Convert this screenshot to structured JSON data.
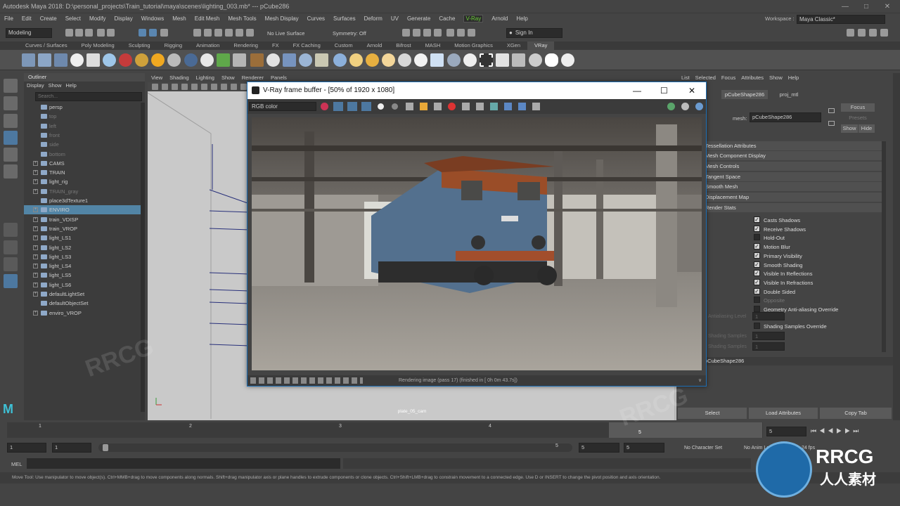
{
  "app": {
    "title": "Autodesk Maya 2018: D:\\personal_projects\\Train_tutorial\\maya\\scenes\\lighting_003.mb*  ---  pCube286"
  },
  "menu": [
    "File",
    "Edit",
    "Create",
    "Select",
    "Modify",
    "Display",
    "Windows",
    "Mesh",
    "Edit Mesh",
    "Mesh Tools",
    "Mesh Display",
    "Curves",
    "Surfaces",
    "Deform",
    "UV",
    "Generate",
    "Cache",
    "V-Ray",
    "Arnold",
    "Help"
  ],
  "workspace": {
    "label": "Workspace :",
    "value": "Maya Classic*"
  },
  "statusline": {
    "mode": "Modeling",
    "live_surface": "No Live Surface",
    "symmetry": "Symmetry: Off",
    "sign_in": "Sign In"
  },
  "shelf_tabs": [
    "Curves / Surfaces",
    "Poly Modeling",
    "Sculpting",
    "Rigging",
    "Animation",
    "Rendering",
    "FX",
    "FX Caching",
    "Custom",
    "Arnold",
    "Bifrost",
    "MASH",
    "Motion Graphics",
    "XGen",
    "VRay"
  ],
  "outliner": {
    "title": "Outliner",
    "menu": [
      "Display",
      "Show",
      "Help"
    ],
    "search_placeholder": "Search...",
    "items": [
      {
        "label": "persp",
        "dim": false,
        "expand": false
      },
      {
        "label": "top",
        "dim": true,
        "expand": false
      },
      {
        "label": "left",
        "dim": true,
        "expand": false
      },
      {
        "label": "front",
        "dim": true,
        "expand": false
      },
      {
        "label": "side",
        "dim": true,
        "expand": false
      },
      {
        "label": "bottom",
        "dim": true,
        "expand": false
      },
      {
        "label": "CAMS",
        "dim": false,
        "expand": true
      },
      {
        "label": "TRAIN",
        "dim": false,
        "expand": true
      },
      {
        "label": "light_rig",
        "dim": false,
        "expand": true
      },
      {
        "label": "TRAIN_gray",
        "dim": true,
        "expand": true
      },
      {
        "label": "place3dTexture1",
        "dim": false,
        "expand": false
      },
      {
        "label": "ENVIRO",
        "dim": false,
        "expand": true,
        "selected": true
      },
      {
        "label": "train_VDISP",
        "dim": false,
        "expand": true
      },
      {
        "label": "train_VROP",
        "dim": false,
        "expand": true
      },
      {
        "label": "light_LS1",
        "dim": false,
        "expand": true
      },
      {
        "label": "light_LS2",
        "dim": false,
        "expand": true
      },
      {
        "label": "light_LS3",
        "dim": false,
        "expand": true
      },
      {
        "label": "light_LS4",
        "dim": false,
        "expand": true
      },
      {
        "label": "light_LS5",
        "dim": false,
        "expand": true
      },
      {
        "label": "light_LS6",
        "dim": false,
        "expand": true
      },
      {
        "label": "defaultLightSet",
        "dim": false,
        "expand": true
      },
      {
        "label": "defaultObjectSet",
        "dim": false,
        "expand": false
      },
      {
        "label": "enviro_VROP",
        "dim": false,
        "expand": true
      }
    ]
  },
  "viewport": {
    "menu": [
      "View",
      "Shading",
      "Lighting",
      "Show",
      "Renderer",
      "Panels"
    ],
    "camera_label": "plate_05_cam"
  },
  "vfb": {
    "title": "V-Ray frame buffer - [50% of 1920 x 1080]",
    "channel": "RGB color",
    "status": "Rendering image (pass 17) (finished in [ 0h  0m 43.7s])"
  },
  "attr": {
    "menu": [
      "List",
      "Selected",
      "Focus",
      "Attributes",
      "Show",
      "Help"
    ],
    "tabs": [
      "pCubeShape286",
      "proj_mtl"
    ],
    "mesh_label": "mesh:",
    "mesh_value": "pCubeShape286",
    "focus": "Focus",
    "presets": "Presets",
    "show": "Show",
    "hide": "Hide",
    "sections": [
      "Tessellation Attributes",
      "Mesh Component Display",
      "Mesh Controls",
      "Tangent Space",
      "Smooth Mesh",
      "Displacement Map",
      "Render Stats"
    ],
    "flags": [
      {
        "label": "Casts Shadows",
        "on": true
      },
      {
        "label": "Receive Shadows",
        "on": true
      },
      {
        "label": "Hold-Out",
        "on": false
      },
      {
        "label": "Motion Blur",
        "on": true
      },
      {
        "label": "Primary Visibility",
        "on": true
      },
      {
        "label": "Smooth Shading",
        "on": true
      },
      {
        "label": "Visible In Reflections",
        "on": true
      },
      {
        "label": "Visible In Refractions",
        "on": true
      },
      {
        "label": "Double Sided",
        "on": true
      },
      {
        "label": "Opposite",
        "on": false,
        "dim": true
      },
      {
        "label": "Geometry Anti-aliasing Override",
        "on": false
      }
    ],
    "aa_level": "Antialiasing Level",
    "aa_value": "1",
    "shading_override": "Shading Samples Override",
    "shading_samples": "Shading Samples",
    "shading_samples_value": "1",
    "max_shading": "Shading Samples",
    "max_shading_value": "1",
    "node_name": "pCubeShape286",
    "buttons": [
      "Select",
      "Load Attributes",
      "Copy Tab"
    ]
  },
  "timeline": {
    "ticks": [
      "1",
      "2",
      "3",
      "4",
      "5"
    ],
    "current": "5",
    "current_marker": "5"
  },
  "range": {
    "start": "1",
    "inner_start": "1",
    "inner_end": "5",
    "end": "5",
    "anim_end": "5",
    "character_set": "No Character Set",
    "anim_layer": "No Anim Layer",
    "fps": "24 fps"
  },
  "cmd": {
    "label": "MEL"
  },
  "help": {
    "text": "Move Tool: Use manipulator to move object(s). Ctrl+MMB+drag to move components along normals. Shift+drag manipulator axis or plane handles to extrude components or clone objects. Ctrl+Shift+LMB+drag to constrain movement to a connected edge. Use D or INSERT to change the pivot position and axis orientation."
  },
  "watermark": {
    "logo_text": "RRCG",
    "logo_sub": "人人素材",
    "bg": "RRCG"
  },
  "colors": {
    "vray_green": "#6cce3a",
    "selection_blue": "#5285a6",
    "window_border": "#1e6fb5"
  }
}
